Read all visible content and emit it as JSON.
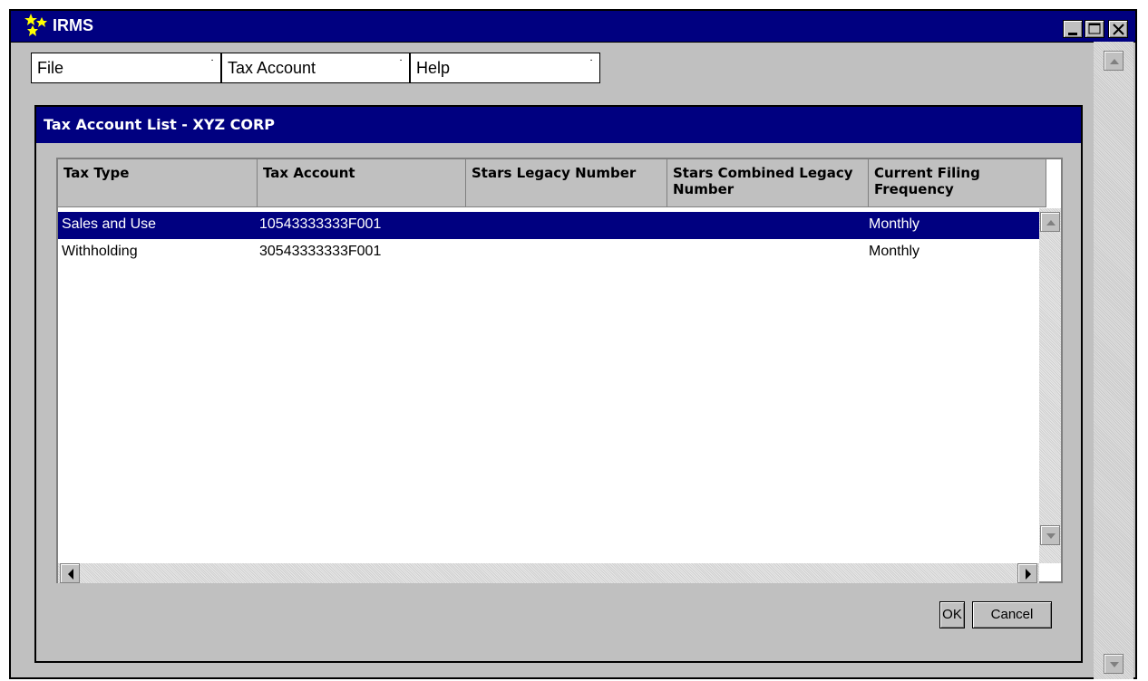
{
  "window": {
    "title": "IRMS"
  },
  "menu": [
    {
      "label": "File"
    },
    {
      "label": "Tax Account"
    },
    {
      "label": "Help"
    }
  ],
  "panel": {
    "title": "Tax Account List - XYZ CORP"
  },
  "table": {
    "columns": [
      "Tax Type",
      "Tax Account",
      "Stars Legacy Number",
      "Stars Combined Legacy Number",
      "Current Filing Frequency"
    ],
    "rows": [
      {
        "tax_type": "Sales and Use",
        "tax_account": "10543333333F001",
        "stars_legacy": "",
        "stars_combined": "",
        "frequency": "Monthly",
        "selected": true
      },
      {
        "tax_type": "Withholding",
        "tax_account": "30543333333F001",
        "stars_legacy": "",
        "stars_combined": "",
        "frequency": "Monthly",
        "selected": false
      }
    ]
  },
  "buttons": {
    "ok": "OK",
    "cancel": "Cancel"
  },
  "colors": {
    "titlebar": "#000080",
    "selection": "#000080",
    "face": "#c0c0c0"
  }
}
